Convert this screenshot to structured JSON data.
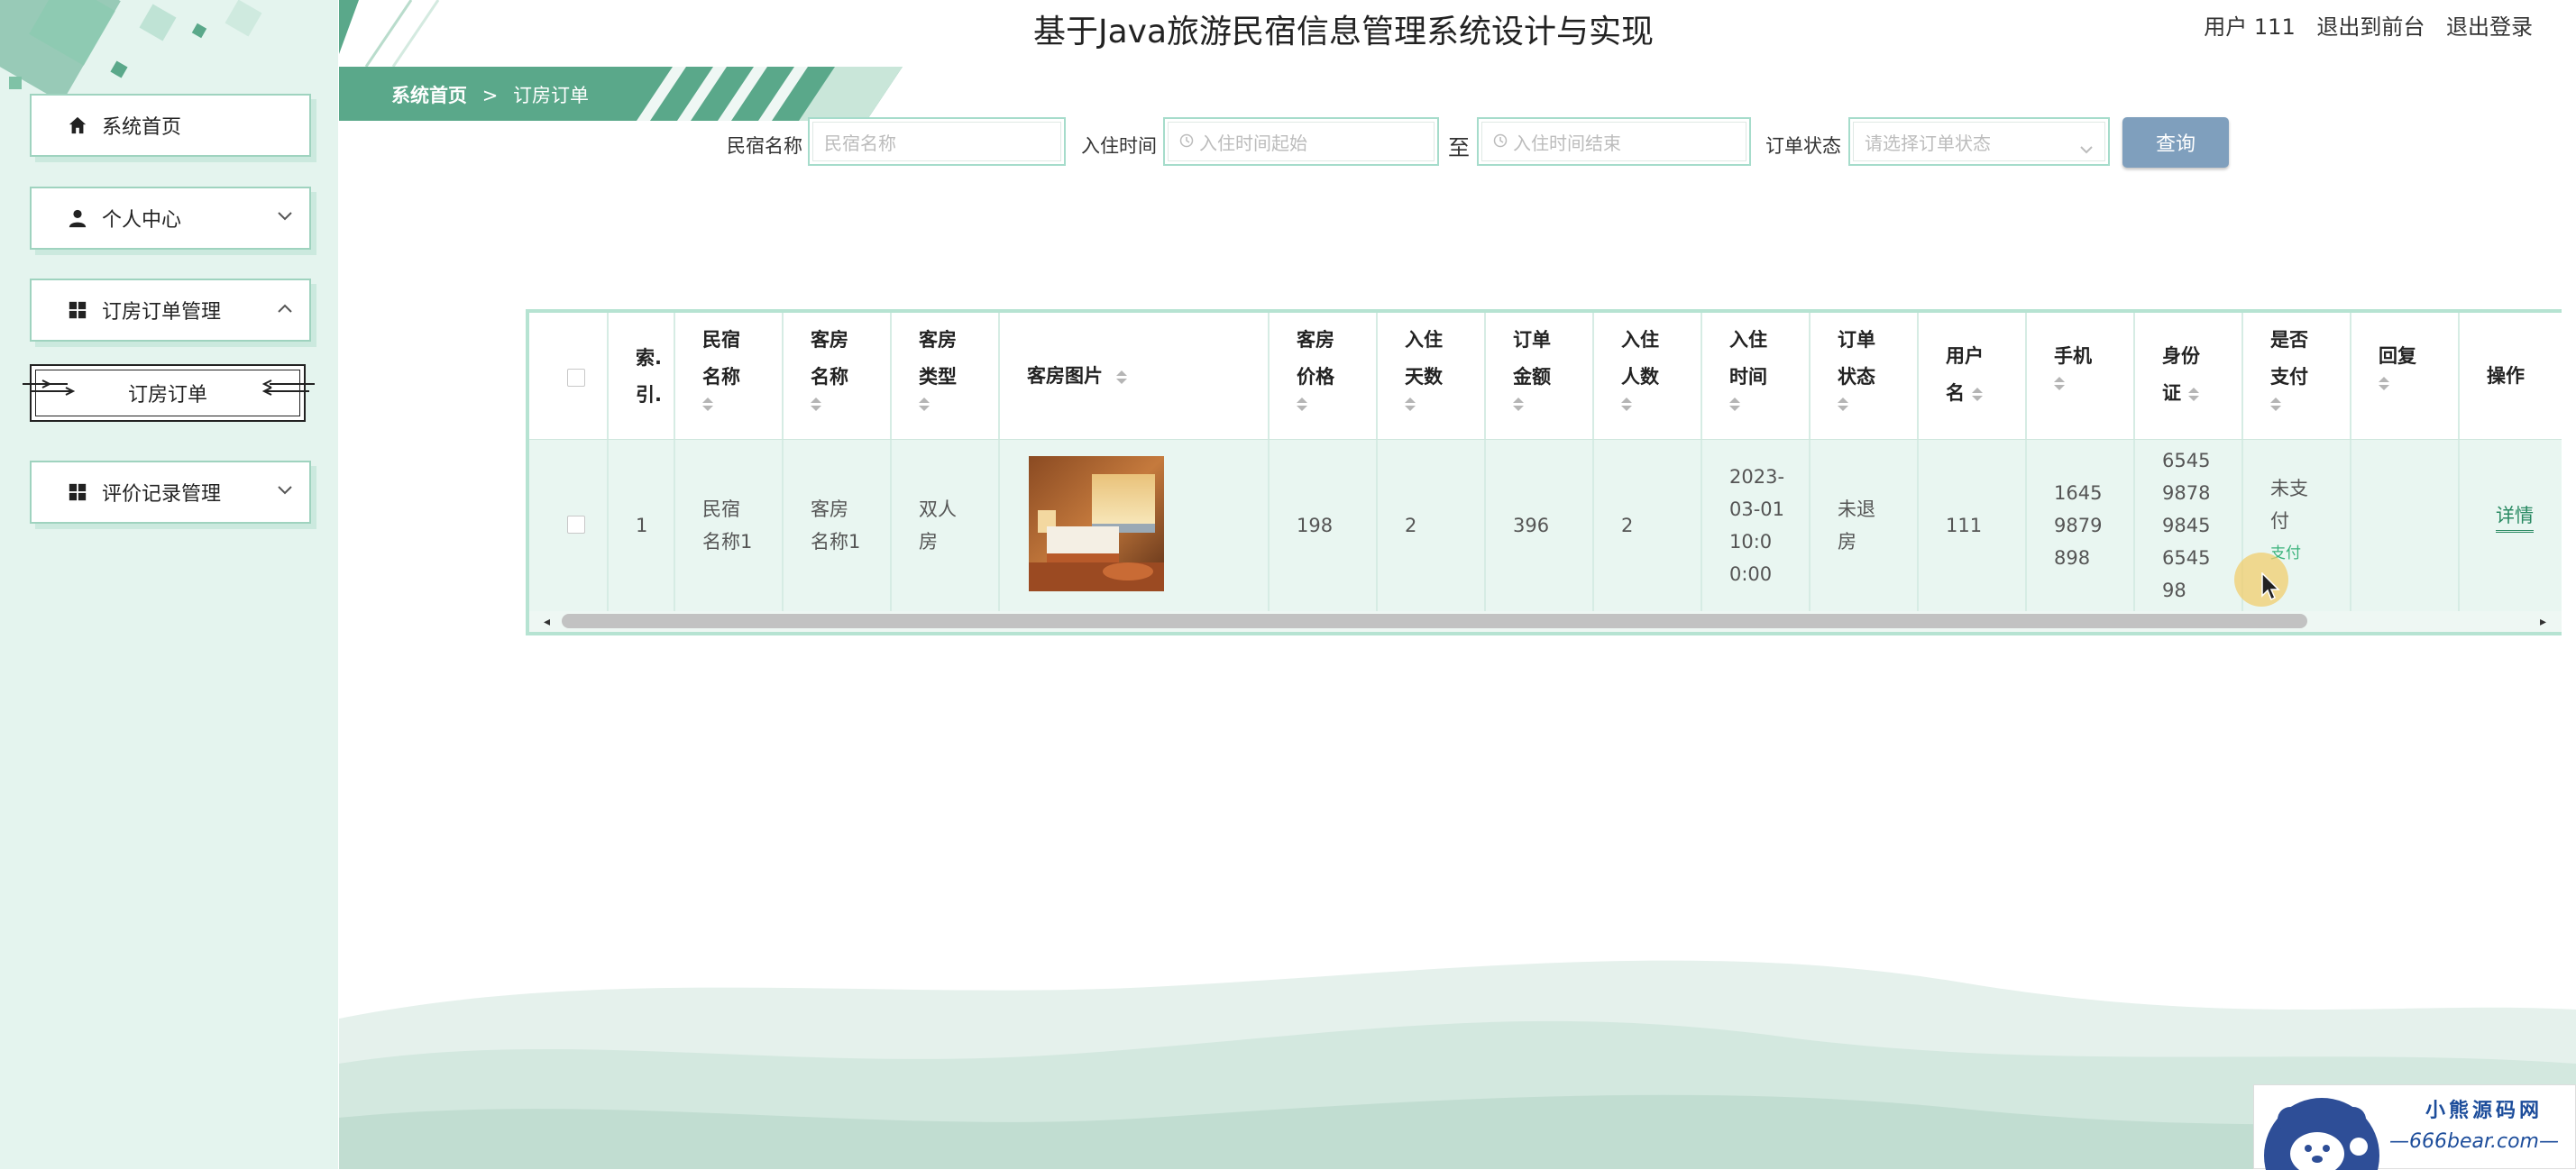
{
  "header": {
    "title": "基于Java旅游民宿信息管理系统设计与实现",
    "user_label": "用户 111",
    "back_to_front": "退出到前台",
    "logout": "退出登录"
  },
  "sidebar": {
    "items": [
      {
        "label": "系统首页",
        "icon": "home-icon"
      },
      {
        "label": "个人中心",
        "icon": "user-icon",
        "chevron": "down"
      },
      {
        "label": "订房订单管理",
        "icon": "grid-icon",
        "chevron": "up"
      },
      {
        "label": "评价记录管理",
        "icon": "grid-icon",
        "chevron": "down"
      }
    ],
    "sub_item": "订房订单"
  },
  "breadcrumb": {
    "home": "系统首页",
    "separator": ">",
    "current": "订房订单"
  },
  "search": {
    "name_label": "民宿名称",
    "name_placeholder": "民宿名称",
    "checkin_label": "入住时间",
    "start_placeholder": "入住时间起始",
    "to_label": "至",
    "end_placeholder": "入住时间结束",
    "status_label": "订单状态",
    "status_placeholder": "请选择订单状态",
    "query_button": "查询"
  },
  "table": {
    "headers": {
      "index": [
        "索.",
        "引."
      ],
      "homestay_name": [
        "民宿",
        "名称"
      ],
      "room_name": [
        "客房",
        "名称"
      ],
      "room_type": [
        "客房",
        "类型"
      ],
      "room_image": "客房图片",
      "room_price": [
        "客房",
        "价格"
      ],
      "days": [
        "入住",
        "天数"
      ],
      "amount": [
        "订单",
        "金额"
      ],
      "persons": [
        "入住",
        "人数"
      ],
      "checkin_time": [
        "入住",
        "时间"
      ],
      "order_status": [
        "订单",
        "状态"
      ],
      "username": [
        "用户",
        "名"
      ],
      "phone": [
        "手机"
      ],
      "id_card": [
        "身份",
        "证"
      ],
      "paid": [
        "是否",
        "支付"
      ],
      "reply": [
        "回复"
      ],
      "action": "操作"
    },
    "row": {
      "index": "1",
      "homestay_name": [
        "民宿",
        "名称1"
      ],
      "room_name": [
        "客房",
        "名称1"
      ],
      "room_type": [
        "双人",
        "房"
      ],
      "room_price": "198",
      "days": "2",
      "amount": "396",
      "persons": "2",
      "checkin_time": [
        "2023-",
        "03-01",
        "10:0",
        "0:00"
      ],
      "order_status": [
        "未退",
        "房"
      ],
      "username": "111",
      "phone": [
        "1645",
        "9879",
        "898"
      ],
      "id_card": [
        "6545",
        "9878",
        "9845",
        "6545",
        "98"
      ],
      "paid": [
        "未支",
        "付"
      ],
      "pay_link": "支付",
      "detail_link": "详情"
    }
  },
  "watermark": {
    "line1": "小熊源码网",
    "line2": "—666bear.com—"
  },
  "colors": {
    "accent": "#5aa88a",
    "sidebar_bg": "#e4f4ee",
    "query_button": "#7f9fbd",
    "row_bg": "#e9f6f1"
  }
}
